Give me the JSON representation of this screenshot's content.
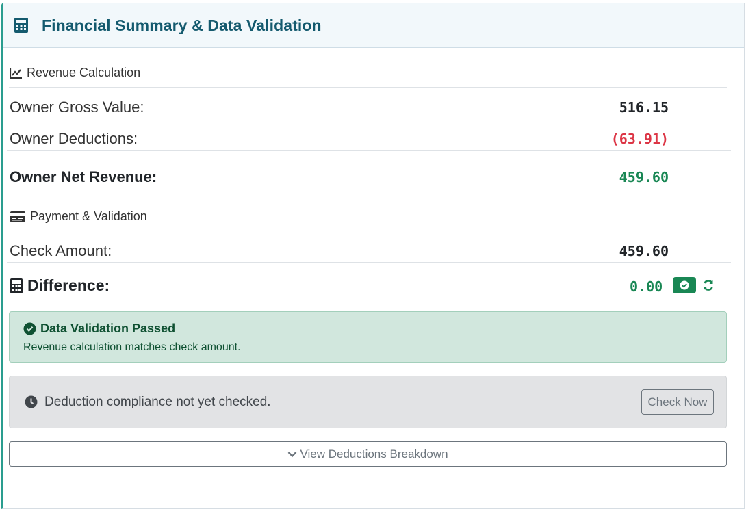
{
  "header": {
    "title": "Financial Summary & Data Validation",
    "icon": "calculator-icon"
  },
  "revenue": {
    "section_title": "Revenue Calculation",
    "section_icon": "chart-line-icon",
    "gross_label": "Owner Gross Value:",
    "gross_value": "516.15",
    "deductions_label": "Owner Deductions:",
    "deductions_value": "(63.91)",
    "net_label": "Owner Net Revenue:",
    "net_value": "459.60"
  },
  "payment": {
    "section_title": "Payment & Validation",
    "section_icon": "credit-card-icon",
    "check_label": "Check Amount:",
    "check_value": "459.60",
    "difference_label": "Difference:",
    "difference_value": "0.00"
  },
  "validation": {
    "title": "Data Validation Passed",
    "message": "Revenue calculation matches check amount."
  },
  "compliance": {
    "message": "Deduction compliance not yet checked.",
    "button_label": "Check Now"
  },
  "breakdown_button": "View Deductions Breakdown",
  "colors": {
    "accent": "#145a6e",
    "positive": "#198754",
    "negative": "#dc3545",
    "success_bg": "#d1e7dd",
    "neutral_bg": "#e2e3e5"
  }
}
